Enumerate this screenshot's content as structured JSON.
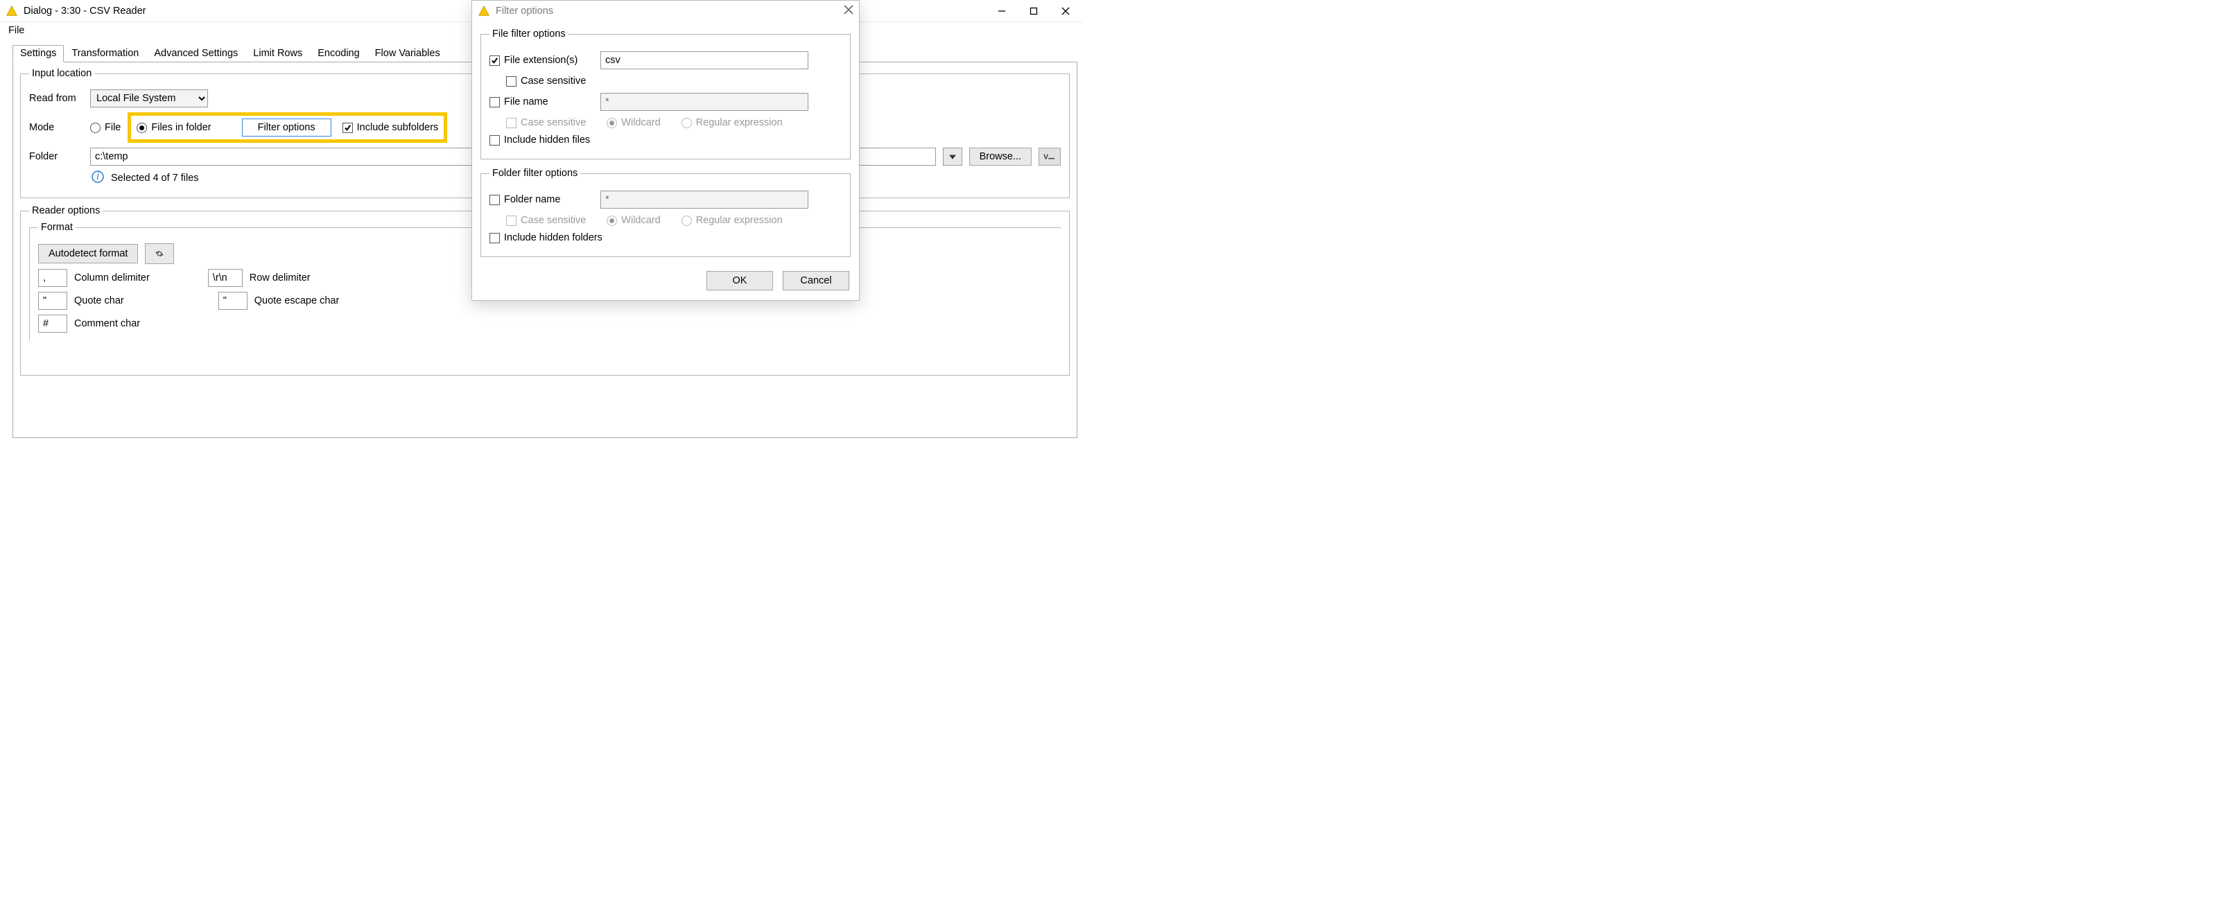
{
  "window": {
    "title": "Dialog - 3:30 - CSV Reader",
    "menu": {
      "file": "File"
    },
    "win_controls": {
      "minimize": "Minimize",
      "maximize": "Maximize",
      "close": "Close"
    }
  },
  "tabs": {
    "settings": "Settings",
    "transformation": "Transformation",
    "advanced": "Advanced Settings",
    "limit": "Limit Rows",
    "encoding": "Encoding",
    "flowvars": "Flow Variables"
  },
  "input_location": {
    "legend": "Input location",
    "read_from_label": "Read from",
    "read_from_value": "Local File System",
    "mode_label": "Mode",
    "mode_file": "File",
    "mode_files_in_folder": "Files in folder",
    "filter_options_btn": "Filter options",
    "include_subfolders": "Include subfolders",
    "folder_label": "Folder",
    "folder_value": "c:\\temp",
    "browse_btn": "Browse...",
    "selected_text": "Selected 4 of 7 files"
  },
  "reader_options": {
    "legend": "Reader options",
    "format_legend": "Format",
    "autodetect_btn": "Autodetect format",
    "col_delim_label": "Column delimiter",
    "col_delim_value": ",",
    "row_delim_label": "Row delimiter",
    "row_delim_value": "\\r\\n",
    "quote_char_label": "Quote char",
    "quote_char_value": "\"",
    "quote_esc_label": "Quote escape char",
    "quote_esc_value": "\"",
    "comment_char_label": "Comment char",
    "comment_char_value": "#"
  },
  "filter_dialog": {
    "title": "Filter options",
    "file_filter_legend": "File filter options",
    "file_ext_label": "File extension(s)",
    "file_ext_checked": true,
    "file_ext_value": "csv",
    "case_sensitive_label": "Case sensitive",
    "file_name_label": "File name",
    "file_name_placeholder": "*",
    "wildcard_label": "Wildcard",
    "regex_label": "Regular expression",
    "include_hidden_files_label": "Include hidden files",
    "folder_filter_legend": "Folder filter options",
    "folder_name_label": "Folder name",
    "folder_name_placeholder": "*",
    "include_hidden_folders_label": "Include hidden folders",
    "ok_btn": "OK",
    "cancel_btn": "Cancel"
  }
}
